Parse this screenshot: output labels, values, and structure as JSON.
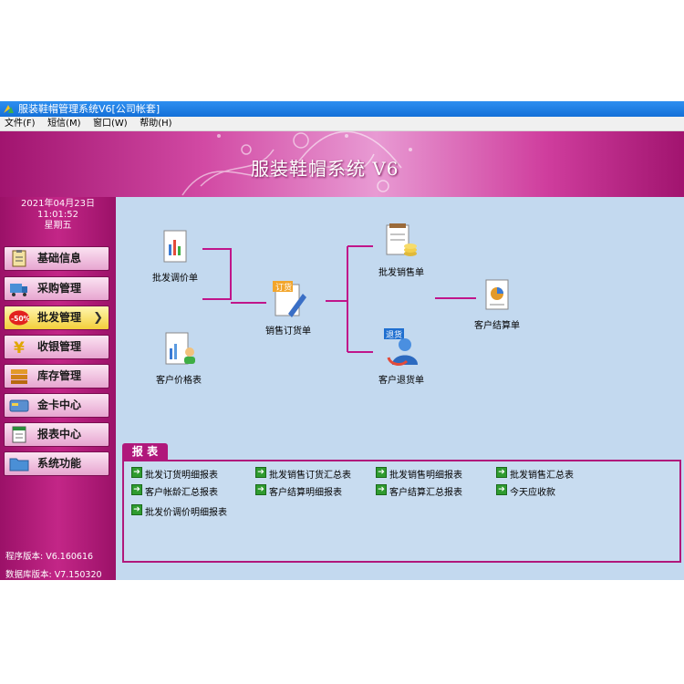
{
  "window": {
    "title": "服装鞋帽管理系统V6[公司帐套]"
  },
  "menu": [
    "文件(F)",
    "短信(M)",
    "窗口(W)",
    "帮助(H)"
  ],
  "banner": {
    "title": "服装鞋帽系统 V6"
  },
  "clock": {
    "date": "2021年04月23日",
    "time": "11:01:52",
    "weekday": "星期五"
  },
  "nav": [
    {
      "label": "基础信息",
      "icon": "clipboard-icon"
    },
    {
      "label": "采购管理",
      "icon": "truck-icon"
    },
    {
      "label": "批发管理",
      "icon": "discount-tag-icon",
      "active": true,
      "badge": "-50%"
    },
    {
      "label": "收银管理",
      "icon": "yen-icon"
    },
    {
      "label": "库存管理",
      "icon": "warehouse-icon"
    },
    {
      "label": "金卡中心",
      "icon": "card-icon"
    },
    {
      "label": "报表中心",
      "icon": "spreadsheet-icon"
    },
    {
      "label": "系统功能",
      "icon": "folder-icon"
    }
  ],
  "version": {
    "program": "程序版本: V6.160616",
    "database": "数据库版本: V7.150320"
  },
  "flow": {
    "price_adjust": "批发调价单",
    "customer_price": "客户价格表",
    "sales_order": "销售订货单",
    "order_badge": "订货",
    "wholesale_sales": "批发销售单",
    "customer_return": "客户退货单",
    "return_badge": "退货",
    "customer_settlement": "客户结算单"
  },
  "reports": {
    "title": "报 表",
    "items": [
      "批发订货明细报表",
      "批发销售订货汇总表",
      "批发销售明细报表",
      "批发销售汇总表",
      "客户帐龄汇总报表",
      "客户结算明细报表",
      "客户结算汇总报表",
      "今天应收款",
      "批发价调价明细报表"
    ]
  },
  "colors": {
    "titlebar": "#1f80e6",
    "brand": "#b0187b",
    "workspace": "#c3d9ef",
    "active_nav": "#f3cf3a",
    "link_arrow": "#2f9b2f"
  }
}
